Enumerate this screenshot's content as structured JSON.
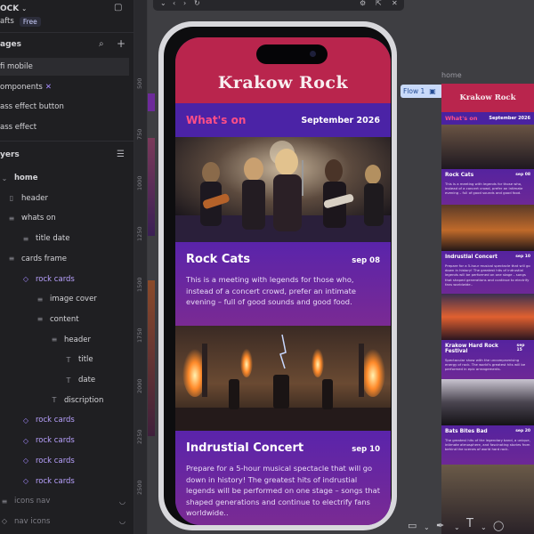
{
  "sidebar": {
    "project_name": "OCK",
    "team": "afts",
    "plan_badge": "Free",
    "pages_header": "ages",
    "pages": [
      {
        "label": "fi mobile",
        "active": true
      },
      {
        "label": "omponents",
        "has_close": true
      },
      {
        "label": "ass effect button"
      },
      {
        "label": "ass effect"
      }
    ],
    "layers_header": "yers",
    "layers": [
      {
        "label": "home",
        "indent": 0,
        "icon": "chevron-down",
        "bold": true
      },
      {
        "label": "header",
        "indent": 1,
        "icon": "frame"
      },
      {
        "label": "whats on",
        "indent": 1,
        "icon": "stack"
      },
      {
        "label": "title date",
        "indent": 2,
        "icon": "stack"
      },
      {
        "label": "cards frame",
        "indent": 1,
        "icon": "stack"
      },
      {
        "label": "rock cards",
        "indent": 2,
        "icon": "component"
      },
      {
        "label": "image cover",
        "indent": 3,
        "icon": "stack"
      },
      {
        "label": "content",
        "indent": 3,
        "icon": "stack"
      },
      {
        "label": "header",
        "indent": 4,
        "icon": "stack"
      },
      {
        "label": "title",
        "indent": 5,
        "icon": "text"
      },
      {
        "label": "date",
        "indent": 5,
        "icon": "text"
      },
      {
        "label": "discription",
        "indent": 4,
        "icon": "text"
      },
      {
        "label": "rock cards",
        "indent": 2,
        "icon": "component"
      },
      {
        "label": "rock cards",
        "indent": 2,
        "icon": "component"
      },
      {
        "label": "rock cards",
        "indent": 2,
        "icon": "component"
      },
      {
        "label": "rock cards",
        "indent": 2,
        "icon": "component"
      },
      {
        "label": "icons nav",
        "indent": 0,
        "icon": "stack",
        "muted": true
      },
      {
        "label": "nav icons",
        "indent": 0,
        "icon": "component",
        "muted": true
      }
    ]
  },
  "ruler": {
    "labels": [
      "500",
      "750",
      "1000",
      "1250",
      "1500",
      "1750",
      "2000",
      "2250",
      "2500"
    ]
  },
  "app": {
    "title": "Krakow Rock",
    "whats_on": "What's on",
    "month": "September 2026",
    "cards": [
      {
        "title": "Rock Cats",
        "date": "sep 08",
        "description": "This is a meeting with legends for those who, instead of a concert crowd, prefer an intimate evening – full of good sounds and good food."
      },
      {
        "title": "Indrustial Concert",
        "date": "sep 10",
        "description": "Prepare for a 5-hour musical spectacle that will go down in history! The greatest hits of indrustial legends will be performed on one stage – songs that shaped generations and continue to electrify fans worldwide.."
      }
    ]
  },
  "preview": {
    "frame_label": "home",
    "flow_label": "Flow 1",
    "title": "Krakow Rock",
    "whats_on": "What's on",
    "month": "September 2026",
    "cards": [
      {
        "title": "Rock Cats",
        "date": "sep 08",
        "description": "This is a meeting with legends for those who, instead of a concert crowd, prefer an intimate evening – full of good sounds and good food."
      },
      {
        "title": "Indrustial Concert",
        "date": "sep 10",
        "description": "Prepare for a 5-hour musical spectacle that will go down in history! The greatest hits of indrustial legends will be performed on one stage – songs that shaped generations and continue to electrify fans worldwide.."
      },
      {
        "title": "Krakow Hard Rock Festival",
        "date": "sep 15",
        "description": "Spectacular show with the uncompromising energy of rock. The world's greatest hits will be performed in epic arrangements."
      },
      {
        "title": "Bats Bites Bad",
        "date": "sep 20",
        "description": "The greatest hits of the legendary band, a unique, intimate atmosphere, and fascinating stories from behind the scenes of world hard rock."
      }
    ]
  },
  "colors": {
    "header_red": "#b9254d",
    "band_purple": "#4b23a6",
    "accent_pink": "#ff4f86",
    "card_gradient_start": "#5a24ab",
    "card_gradient_end": "#7a2a93"
  },
  "toolbar_icons": [
    "close-icon",
    "back-icon",
    "forward-icon",
    "refresh-icon",
    "settings-icon",
    "external-icon",
    "more-icon"
  ],
  "bottom_tools": [
    "rectangle-icon",
    "path-icon",
    "pen-icon",
    "text-icon",
    "comment-icon"
  ]
}
